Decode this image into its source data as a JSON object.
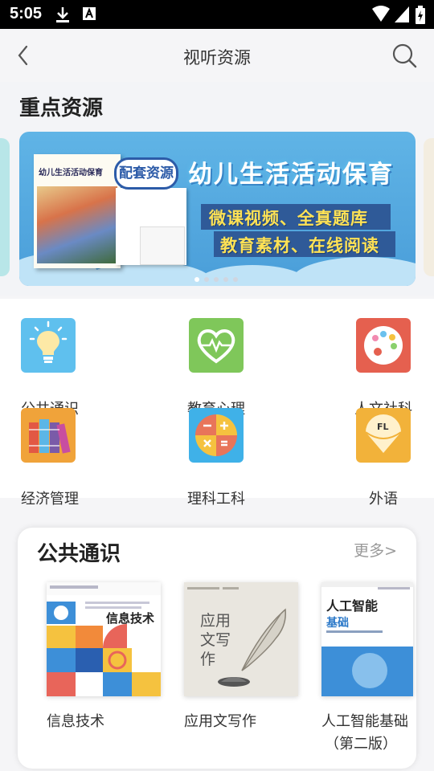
{
  "status_bar": {
    "time": "5:05"
  },
  "header": {
    "title": "视听资源"
  },
  "key_resources": {
    "heading": "重点资源",
    "banner": {
      "book_title": "幼儿生活活动保育",
      "tag": "配套资源",
      "title": "幼儿生活活动保育",
      "line1": "微课视频、全真题库",
      "line2": "教育素材、在线阅读"
    },
    "carousel_index": 1,
    "carousel_total": 5
  },
  "categories": [
    {
      "label": "公共通识",
      "icon": "lightbulb-icon",
      "color": "#5fc0ee"
    },
    {
      "label": "教育心理",
      "icon": "heart-pulse-icon",
      "color": "#7fc75a"
    },
    {
      "label": "人文社科",
      "icon": "palette-icon",
      "color": "#e5604f"
    },
    {
      "label": "经济管理",
      "icon": "books-icon",
      "color": "#f0a33a"
    },
    {
      "label": "理科工科",
      "icon": "math-symbols-icon",
      "color": "#3fb1e8"
    },
    {
      "label": "外语",
      "icon": "language-icon",
      "color": "#f2b23a"
    }
  ],
  "public_knowledge": {
    "heading": "公共通识",
    "more": "更多>",
    "books": [
      {
        "name": "信息技术",
        "cover_title": "信息技术"
      },
      {
        "name": "应用文写作",
        "cover_title": "应用文写作"
      },
      {
        "name": "人工智能基础（第二版）",
        "name_line1": "人工智能基础",
        "name_line2": "（第二版）",
        "cover_title": "人工智能",
        "cover_subtitle": "基础"
      }
    ]
  }
}
